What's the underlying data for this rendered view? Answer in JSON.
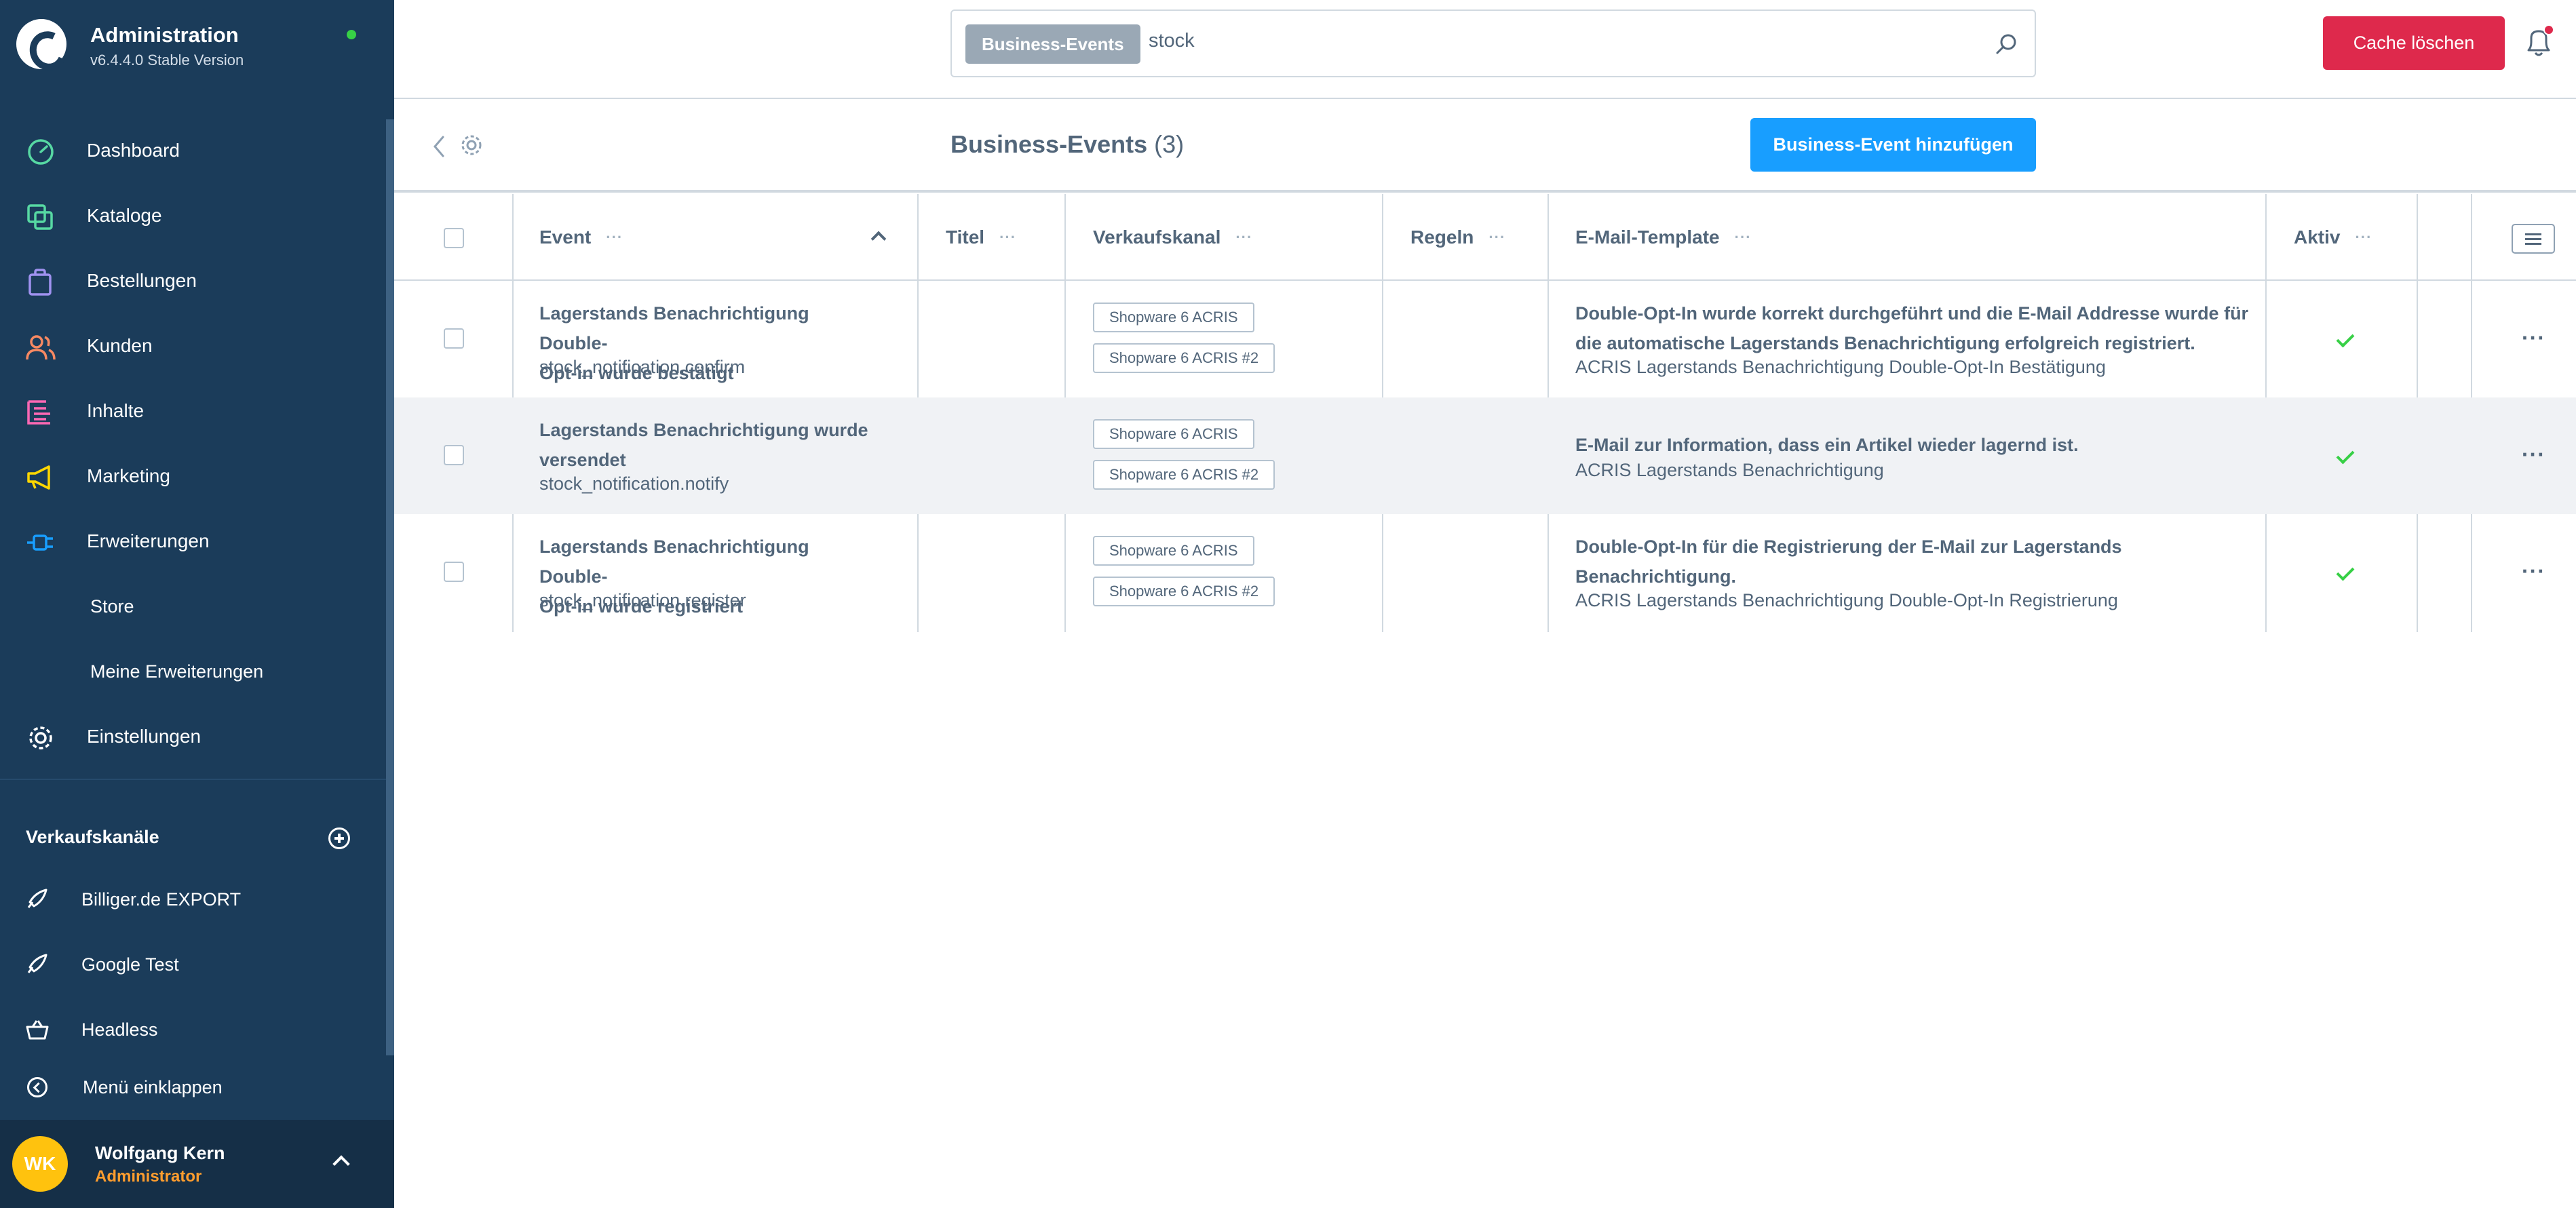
{
  "app": {
    "title": "Administration",
    "version": "v6.4.4.0 Stable Version"
  },
  "nav": [
    {
      "label": "Dashboard",
      "icon": "gauge-icon",
      "color": "#57d9a3"
    },
    {
      "label": "Kataloge",
      "icon": "catalog-icon",
      "color": "#57d9a3"
    },
    {
      "label": "Bestellungen",
      "icon": "bag-icon",
      "color": "#a092f0"
    },
    {
      "label": "Kunden",
      "icon": "users-icon",
      "color": "#f88962"
    },
    {
      "label": "Inhalte",
      "icon": "content-icon",
      "color": "#ff68b4"
    },
    {
      "label": "Marketing",
      "icon": "megaphone-icon",
      "color": "#ffd700"
    },
    {
      "label": "Erweiterungen",
      "icon": "plug-icon",
      "color": "#189eff"
    },
    {
      "label": "Einstellungen",
      "icon": "gear-icon",
      "color": "#ffffff"
    }
  ],
  "subnav": [
    "Store",
    "Meine Erweiterungen"
  ],
  "sales_channels": {
    "title": "Verkaufskanäle",
    "items": [
      {
        "label": "Billiger.de EXPORT",
        "icon": "rocket-icon"
      },
      {
        "label": "Google Test",
        "icon": "rocket-icon"
      },
      {
        "label": "Headless",
        "icon": "basket-icon"
      }
    ],
    "collapse_label": "Menü einklappen"
  },
  "user": {
    "initials": "WK",
    "name": "Wolfgang Kern",
    "role": "Administrator"
  },
  "search": {
    "tag": "Business-Events",
    "value": "stock"
  },
  "topbar": {
    "cache_button": "Cache löschen"
  },
  "page": {
    "title": "Business-Events",
    "count": "(3)",
    "add_button": "Business-Event hinzufügen"
  },
  "columns": {
    "event": "Event",
    "title": "Titel",
    "sales_channel": "Verkaufskanal",
    "rules": "Regeln",
    "mail_template": "E-Mail-Template",
    "active": "Aktiv",
    "menu_dots": "···"
  },
  "rows": [
    {
      "event_title_1": "Lagerstands Benachrichtigung Double-",
      "event_title_2": "Opt-in wurde bestätigt",
      "event_name": "stock_notification.confirm",
      "channels": [
        "Shopware 6 ACRIS",
        "Shopware 6 ACRIS #2"
      ],
      "mail_line_1": "Double-Opt-In wurde korrekt durchgeführt und die E-Mail Addresse wurde für",
      "mail_line_2": "die automatische Lagerstands Benachrichtigung erfolgreich registriert.",
      "mail_template": "ACRIS Lagerstands Benachrichtigung Double-Opt-In Bestätigung",
      "active": true,
      "actions": "···"
    },
    {
      "event_title_1": "Lagerstands Benachrichtigung wurde",
      "event_title_2": "versendet",
      "event_name": "stock_notification.notify",
      "channels": [
        "Shopware 6 ACRIS",
        "Shopware 6 ACRIS #2"
      ],
      "mail_line_1": "E-Mail zur Information, dass ein Artikel wieder lagernd ist.",
      "mail_line_2": "",
      "mail_template": "ACRIS Lagerstands Benachrichtigung",
      "active": true,
      "actions": "···"
    },
    {
      "event_title_1": "Lagerstands Benachrichtigung Double-",
      "event_title_2": "Opt-in wurde registriert",
      "event_name": "stock_notification.register",
      "channels": [
        "Shopware 6 ACRIS",
        "Shopware 6 ACRIS #2"
      ],
      "mail_line_1": "Double-Opt-In für die Registrierung der E-Mail zur Lagerstands",
      "mail_line_2": "Benachrichtigung.",
      "mail_template": "ACRIS Lagerstands Benachrichtigung Double-Opt-In Registrierung",
      "active": true,
      "actions": "···"
    }
  ]
}
